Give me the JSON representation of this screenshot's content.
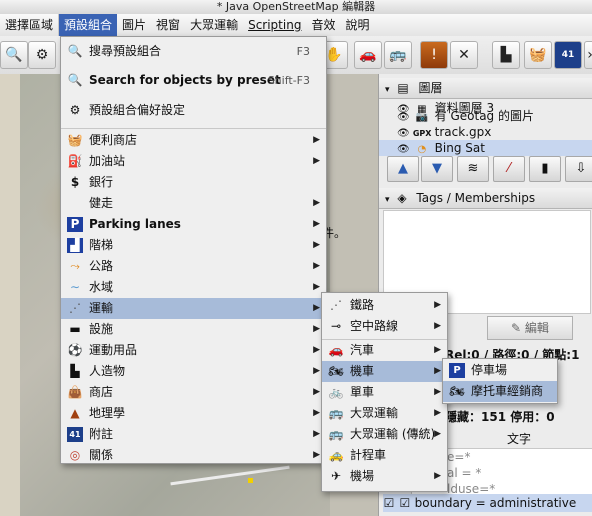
{
  "window": {
    "title": "* Java OpenStreetMap 編輯器"
  },
  "menubar": [
    "選擇區域",
    "預設組合",
    "圖片",
    "視窗",
    "大眾運輸",
    "Scripting",
    "音效",
    "說明"
  ],
  "map": {
    "fragment_text": "件。"
  },
  "right_panel": {
    "layers_title": "圖層",
    "layers": [
      {
        "label": "資料圖層 3"
      },
      {
        "label": "有 Geotag 的圖片"
      },
      {
        "label": "track.gpx",
        "prefix": "GPX"
      },
      {
        "label": "Bing Sat"
      }
    ],
    "tags_title": "Tags / Memberships",
    "edit_button": "編輯",
    "stats": "Rel:0 / 路徑:0 / 節點:1",
    "hidden": "隱藏：151 停用：0",
    "column_header": "文字",
    "filter_rows": [
      "e=*",
      "al = *",
      "lduse=*"
    ],
    "selected_filter": "boundary = administrative"
  },
  "presets_menu": {
    "top_items": [
      {
        "label": "搜尋預設組合",
        "shortcut": "F3"
      },
      {
        "label": "Search for objects by preset",
        "shortcut": "Shift-F3"
      },
      {
        "label": "預設組合偏好設定",
        "shortcut": ""
      }
    ],
    "items": [
      "便利商店",
      "加油站",
      "銀行",
      "健走",
      "Parking lanes",
      "階梯",
      "公路",
      "水域",
      "運輸",
      "設施",
      "運動用品",
      "人造物",
      "商店",
      "地理學",
      "附註",
      "關係"
    ]
  },
  "transport_menu": {
    "items": [
      "鐵路",
      "空中路線",
      "汽車",
      "機車",
      "單車",
      "大眾運輸",
      "大眾運輸 (傳統)",
      "計程車",
      "機場"
    ]
  },
  "moto_menu": {
    "items": [
      "停車場",
      "摩托車經銷商"
    ]
  }
}
